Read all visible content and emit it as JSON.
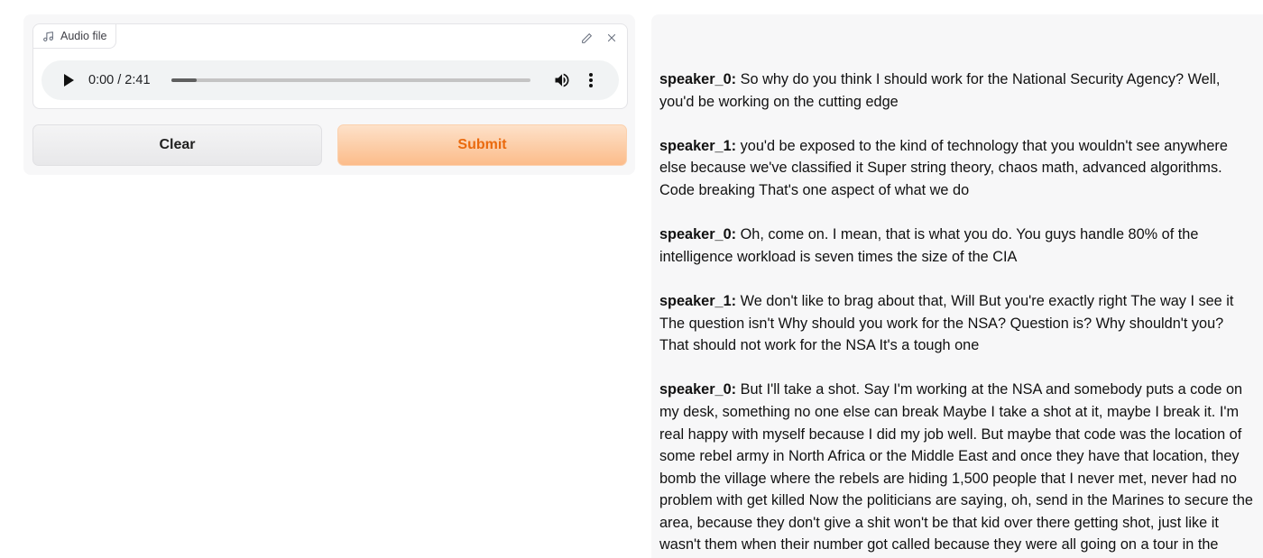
{
  "audio": {
    "label": "Audio file",
    "time_display": "0:00 / 2:41",
    "progress": 0.07
  },
  "buttons": {
    "clear_label": "Clear",
    "submit_label": "Submit"
  },
  "colors": {
    "submit_text": "#ea6a0e",
    "submit_bg": "#fcbc8a",
    "panel_bg": "#f7f7f8"
  },
  "transcript": [
    {
      "speaker": "speaker_0:",
      "text": "So why do you think I should work for the National Security Agency? Well, you'd be working on the cutting edge"
    },
    {
      "speaker": "speaker_1:",
      "text": "you'd be exposed to the kind of technology that you wouldn't see anywhere else because we've classified it Super string theory, chaos math, advanced algorithms. Code breaking That's one aspect of what we do"
    },
    {
      "speaker": "speaker_0:",
      "text": "Oh, come on. I mean, that is what you do. You guys handle 80% of the intelligence workload is seven times the size of the CIA"
    },
    {
      "speaker": "speaker_1:",
      "text": "We don't like to brag about that, Will But you're exactly right The way I see it The question isn't Why should you work for the NSA? Question is? Why shouldn't you? That should not work for the NSA It's a tough one"
    },
    {
      "speaker": "speaker_0:",
      "text": "But I'll take a shot. Say I'm working at the NSA and somebody puts a code on my desk, something no one else can break Maybe I take a shot at it, maybe I break it. I'm real happy with myself because I did my job well. But maybe that code was the location of some rebel army in North Africa or the Middle East and once they have that location, they bomb the village where the rebels are hiding 1,500 people that I never met, never had no problem with get killed Now the politicians are saying, oh, send in the Marines to secure the area, because they don't give a shit won't be that kid over there getting shot, just like it wasn't them when their number got called because they were all going on a tour in the"
    }
  ]
}
